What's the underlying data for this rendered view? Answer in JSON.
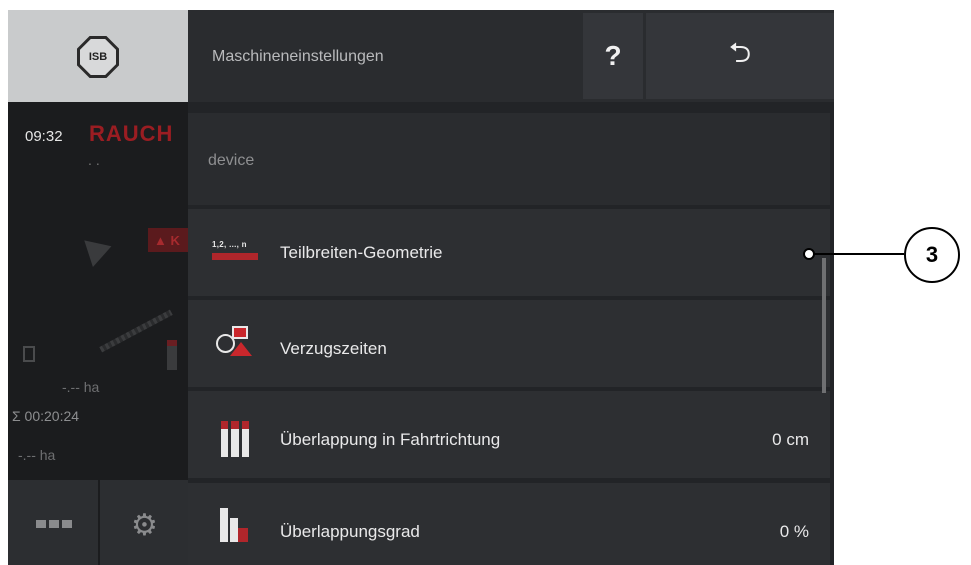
{
  "header": {
    "title": "Maschineneinstellungen",
    "help_label": "?",
    "back_label": "⮌"
  },
  "left_panel": {
    "isb_label": "ISB",
    "time": "09:32",
    "brand": "RAUCH",
    "dots": "..",
    "warning": "▲ K",
    "area_1": "-.-- ha",
    "timer": "Σ 00:20:24",
    "area_2": "-.-- ha"
  },
  "section": {
    "label": "device"
  },
  "rows": [
    {
      "label": "Teilbreiten-Geometrie",
      "value": "",
      "icon": "partial-width-geometry-icon",
      "icon_text": "1,2, ..., n"
    },
    {
      "label": "Verzugszeiten",
      "value": "",
      "icon": "delay-times-icon"
    },
    {
      "label": "Überlappung in Fahrtrichtung",
      "value": "0 cm",
      "icon": "overlap-direction-icon"
    },
    {
      "label": "Überlappungsgrad",
      "value": "0 %",
      "icon": "overlap-degree-icon"
    }
  ],
  "callout": {
    "number": "3"
  },
  "colors": {
    "accent_red": "#b0262b",
    "background": "#222427",
    "row_bg": "#2d2f32"
  }
}
